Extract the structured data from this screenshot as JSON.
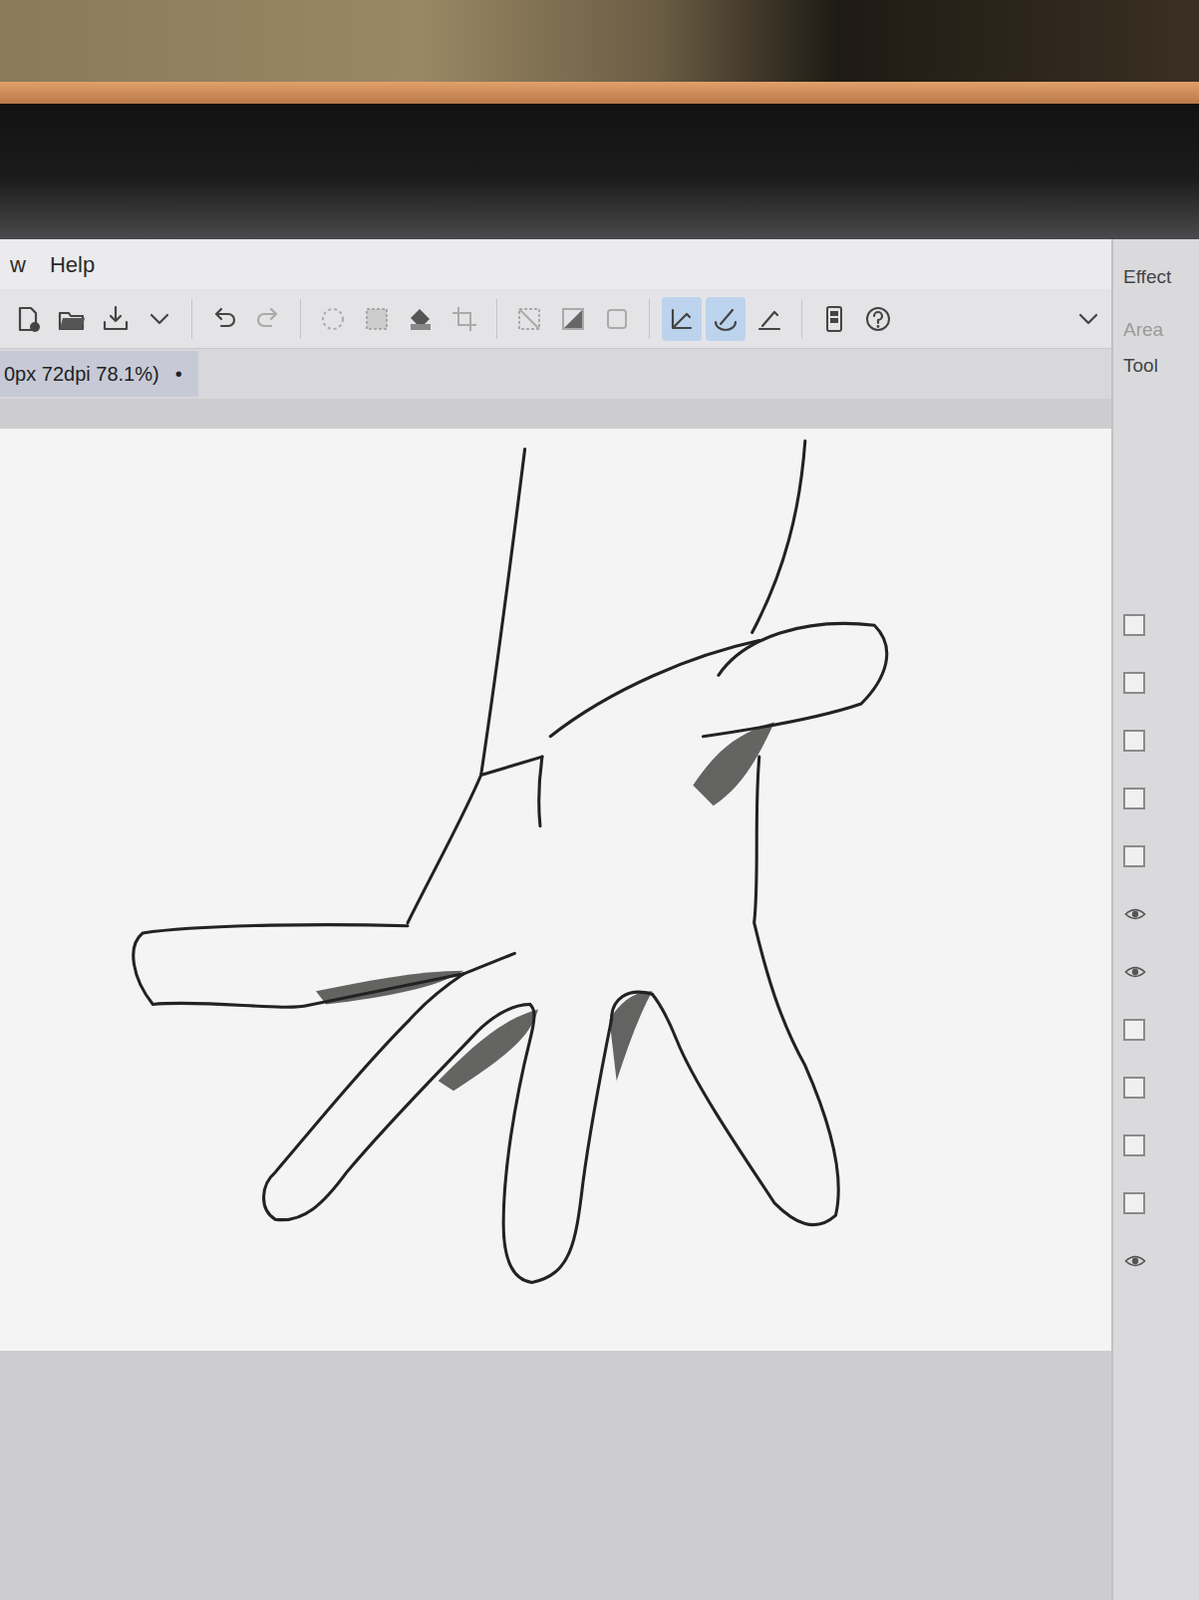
{
  "menu": [
    "w",
    "Help"
  ],
  "toolbar": [
    {
      "selected": false
    },
    {
      "selected": false
    },
    {
      "selected": false
    },
    {
      "selected": false
    },
    {
      "selected": false
    },
    {
      "selected": false
    },
    {
      "selected": false
    },
    {
      "selected": false
    },
    {
      "selected": false
    },
    {
      "selected": false
    },
    {
      "selected": false
    },
    {
      "selected": false
    },
    {
      "selected": false
    },
    {
      "selected": true
    },
    {
      "selected": true
    },
    {
      "selected": false
    },
    {
      "selected": false
    },
    {
      "selected": false
    }
  ],
  "document_tab": {
    "label": "0px 72dpi 78.1%)",
    "modified_mark": "•"
  },
  "side_panel": {
    "title": "Effect",
    "area_label": "Area",
    "tool_label": "Tool"
  },
  "layers": [
    {
      "visible": false
    },
    {
      "visible": false
    },
    {
      "visible": false
    },
    {
      "visible": false
    },
    {
      "visible": false
    },
    {
      "visible": true
    },
    {
      "visible": true
    },
    {
      "visible": false
    },
    {
      "visible": false
    },
    {
      "visible": false
    },
    {
      "visible": false
    },
    {
      "visible": true
    }
  ]
}
